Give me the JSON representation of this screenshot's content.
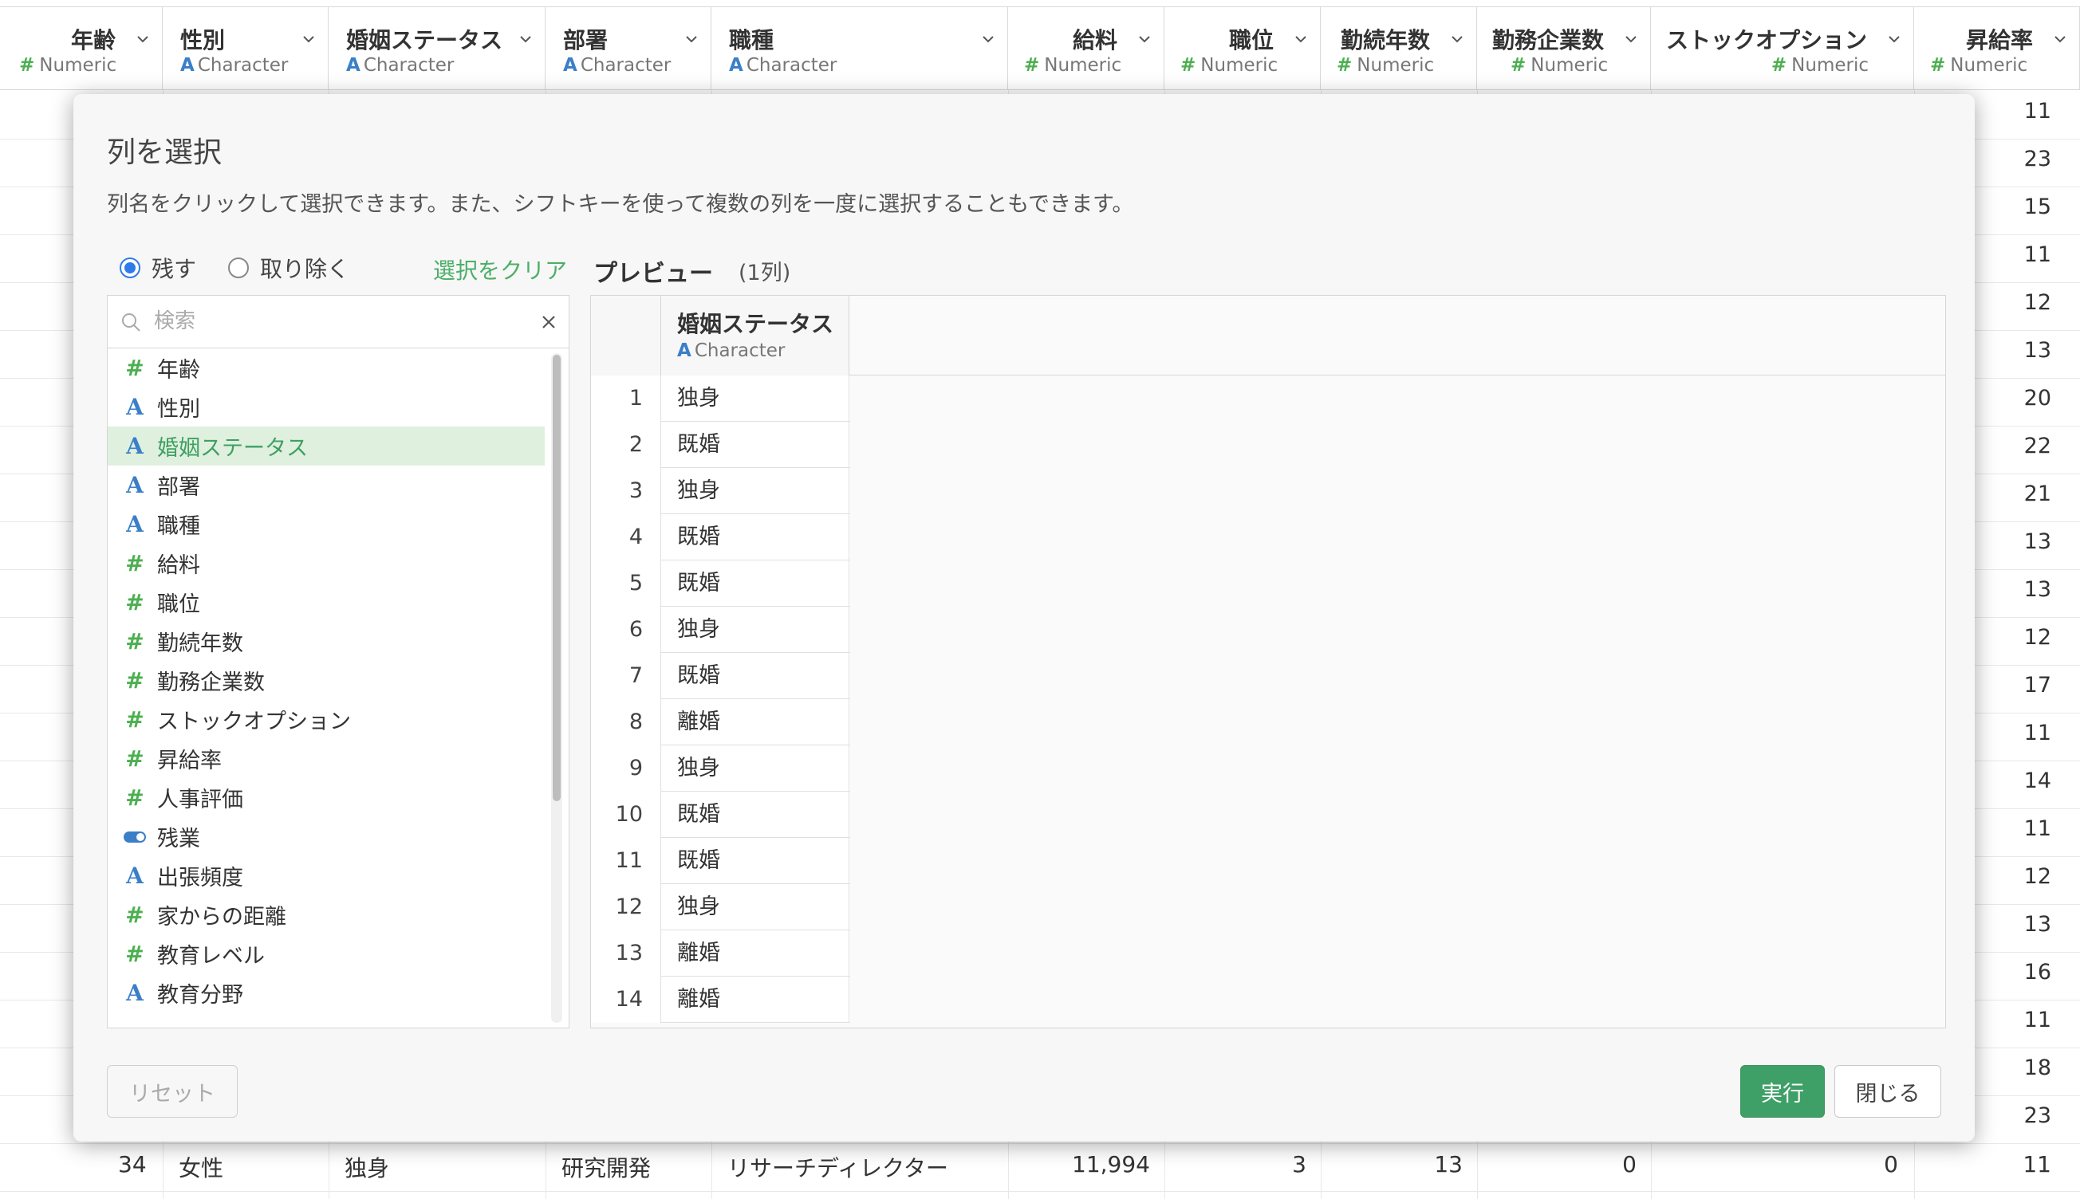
{
  "spreadsheet": {
    "columns": [
      {
        "name": "年齢",
        "type": "Numeric",
        "type_icon": "#"
      },
      {
        "name": "性別",
        "type": "Character",
        "type_icon": "A"
      },
      {
        "name": "婚姻ステータス",
        "type": "Character",
        "type_icon": "A"
      },
      {
        "name": "部署",
        "type": "Character",
        "type_icon": "A"
      },
      {
        "name": "職種",
        "type": "Character",
        "type_icon": "A"
      },
      {
        "name": "給料",
        "type": "Numeric",
        "type_icon": "#"
      },
      {
        "name": "職位",
        "type": "Numeric",
        "type_icon": "#"
      },
      {
        "name": "勤続年数",
        "type": "Numeric",
        "type_icon": "#"
      },
      {
        "name": "勤務企業数",
        "type": "Numeric",
        "type_icon": "#"
      },
      {
        "name": "ストックオプション",
        "type": "Numeric",
        "type_icon": "#"
      },
      {
        "name": "昇給率",
        "type": "Numeric",
        "type_icon": "#"
      }
    ],
    "raise_rate_values": [
      "11",
      "23",
      "15",
      "11",
      "12",
      "13",
      "20",
      "22",
      "21",
      "13",
      "13",
      "12",
      "17",
      "11",
      "14",
      "11",
      "12",
      "13",
      "16",
      "11",
      "18",
      "23"
    ],
    "last_row": {
      "age": "34",
      "gender": "女性",
      "marital": "独身",
      "dept": "研究開発",
      "job": "リサーチディレクター",
      "salary": "11,994",
      "level": "3",
      "years": "13",
      "companies": "0",
      "stock": "0",
      "raise": "11"
    }
  },
  "modal": {
    "title": "列を選択",
    "description": "列名をクリックして選択できます。また、シフトキーを使って複数の列を一度に選択することもできます。",
    "radio_keep": "残す",
    "radio_remove": "取り除く",
    "clear_selection": "選択をクリア",
    "preview_label": "プレビュー",
    "preview_count": "(1列)",
    "search_placeholder": "検索",
    "column_list": [
      {
        "name": "年齢",
        "kind": "num"
      },
      {
        "name": "性別",
        "kind": "chr"
      },
      {
        "name": "婚姻ステータス",
        "kind": "chr",
        "selected": true
      },
      {
        "name": "部署",
        "kind": "chr"
      },
      {
        "name": "職種",
        "kind": "chr"
      },
      {
        "name": "給料",
        "kind": "num"
      },
      {
        "name": "職位",
        "kind": "num"
      },
      {
        "name": "勤続年数",
        "kind": "num"
      },
      {
        "name": "勤務企業数",
        "kind": "num"
      },
      {
        "name": "ストックオプション",
        "kind": "num"
      },
      {
        "name": "昇給率",
        "kind": "num"
      },
      {
        "name": "人事評価",
        "kind": "num"
      },
      {
        "name": "残業",
        "kind": "bool"
      },
      {
        "name": "出張頻度",
        "kind": "chr"
      },
      {
        "name": "家からの距離",
        "kind": "num"
      },
      {
        "name": "教育レベル",
        "kind": "num"
      },
      {
        "name": "教育分野",
        "kind": "chr"
      }
    ],
    "preview_column": {
      "name": "婚姻ステータス",
      "type": "Character",
      "type_icon": "A"
    },
    "preview_rows": [
      {
        "index": "1",
        "value": "独身"
      },
      {
        "index": "2",
        "value": "既婚"
      },
      {
        "index": "3",
        "value": "独身"
      },
      {
        "index": "4",
        "value": "既婚"
      },
      {
        "index": "5",
        "value": "既婚"
      },
      {
        "index": "6",
        "value": "独身"
      },
      {
        "index": "7",
        "value": "既婚"
      },
      {
        "index": "8",
        "value": "離婚"
      },
      {
        "index": "9",
        "value": "独身"
      },
      {
        "index": "10",
        "value": "既婚"
      },
      {
        "index": "11",
        "value": "既婚"
      },
      {
        "index": "12",
        "value": "独身"
      },
      {
        "index": "13",
        "value": "離婚"
      },
      {
        "index": "14",
        "value": "離婚"
      }
    ],
    "btn_reset": "リセット",
    "btn_run": "実行",
    "btn_close": "閉じる",
    "colors": {
      "accent_green": "#3fa067",
      "radio_blue": "#2f7bea",
      "numeric_icon": "#4caf50",
      "character_icon": "#3a7fc8"
    }
  }
}
